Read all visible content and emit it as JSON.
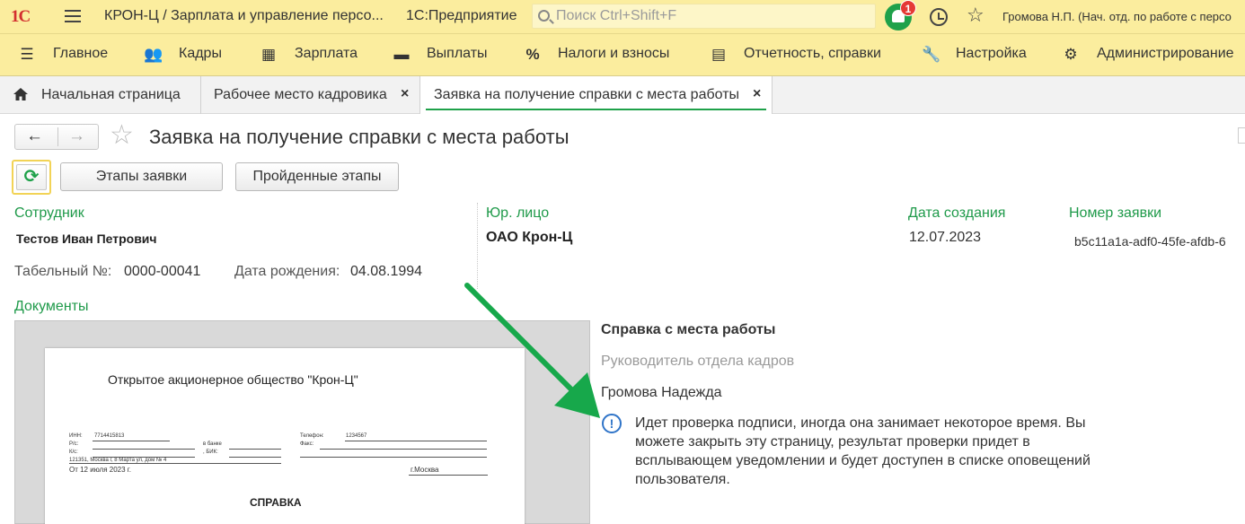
{
  "header": {
    "logo": "1С",
    "app_title": "КРОН-Ц / Зарплата и управление персо...",
    "platform": "1С:Предприятие",
    "search_placeholder": "Поиск Ctrl+Shift+F",
    "notification_count": "1",
    "user": "Громова Н.П. (Нач. отд. по работе с персо"
  },
  "menu": [
    {
      "label": "Главное",
      "icon": "menu-list-icon"
    },
    {
      "label": "Кадры",
      "icon": "people-icon"
    },
    {
      "label": "Зарплата",
      "icon": "calculator-icon"
    },
    {
      "label": "Выплаты",
      "icon": "wallet-icon"
    },
    {
      "label": "Налоги и взносы",
      "icon": "percent-icon"
    },
    {
      "label": "Отчетность, справки",
      "icon": "reports-icon"
    },
    {
      "label": "Настройка",
      "icon": "wrench-icon"
    },
    {
      "label": "Администрирование",
      "icon": "gear-icon"
    }
  ],
  "tabs": [
    {
      "label": "Начальная страница"
    },
    {
      "label": "Рабочее место кадровика",
      "close": "×"
    },
    {
      "label": "Заявка на получение справки с места работы",
      "close": "×"
    }
  ],
  "form": {
    "title": "Заявка на получение справки с места работы",
    "stages_button": "Этапы заявки",
    "passed_button": "Пройденные этапы",
    "employee_label": "Сотрудник",
    "employee_value": "Тестов Иван Петрович",
    "entity_label": "Юр. лицо",
    "entity_value": "ОАО Крон-Ц",
    "created_label": "Дата создания",
    "created_value": "12.07.2023",
    "number_label": "Номер заявки",
    "number_value": "b5c11a1a-adf0-45fe-afdb-6",
    "tabnum_label": "Табельный №:",
    "tabnum_value": "0000-00041",
    "birth_label": "Дата рождения:",
    "birth_value": "04.08.1994",
    "documents_label": "Документы"
  },
  "document": {
    "org": "Открытое акционерное общество \"Крон-Ц\"",
    "inn_label": "ИНН:",
    "inn_value": "7714415813",
    "rs_label": "Р/с:",
    "ks_label": "К/с:",
    "bank_label": "в банке",
    "bik_label": ", БИК:",
    "phone_label": "Телефон:",
    "phone_value": "1234567",
    "fax_label": "Факс:",
    "address": "121351, Москва г, 8 Марта ул, дом № 4",
    "date": "От 12 июля 2023 г.",
    "city": "г.Москва",
    "heading": "СПРАВКА"
  },
  "certificate": {
    "title": "Справка с места работы",
    "role": "Руководитель отдела кадров",
    "person": "Громова Надежда",
    "info": "Идет проверка подписи, иногда она занимает некоторое время. Вы можете закрыть эту страницу, результат проверки придет в всплывающем уведомлении и будет доступен в списке оповещений пользователя."
  },
  "colors": {
    "header_bg": "#fbed9e",
    "accent_green": "#1f9a4a",
    "arrow_green": "#17a84b",
    "info_blue": "#2f74c8",
    "logo_red": "#d32f2f"
  }
}
